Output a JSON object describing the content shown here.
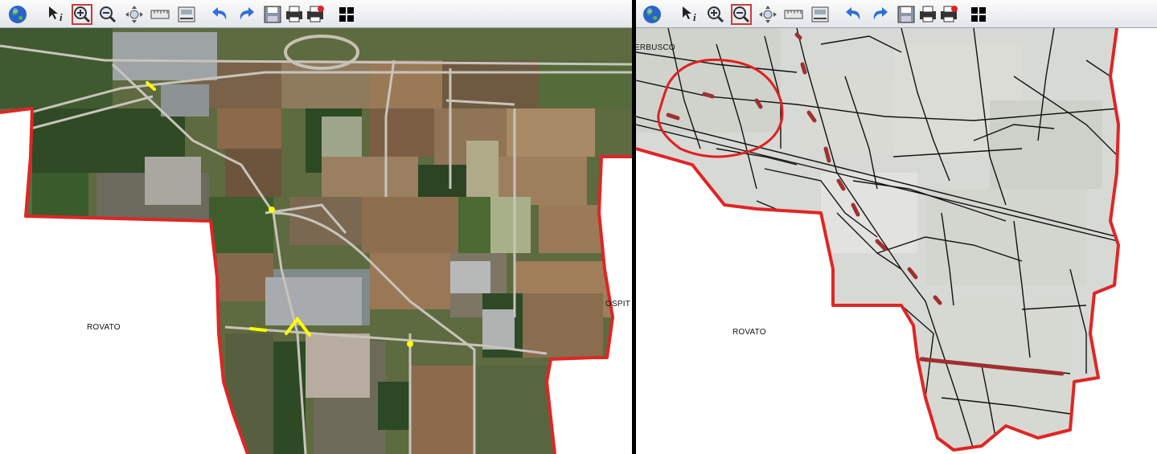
{
  "left_map": {
    "view": "satellite",
    "labels": {
      "rovato": "ROVATO",
      "ospit": "OSPIT"
    },
    "boundary_color": "#e02525",
    "highlight_color": "#ffff00"
  },
  "right_map": {
    "view": "road-network",
    "labels": {
      "erbusco": "ERBUSCO",
      "rovato": "ROVATO"
    },
    "boundary_color": "#e02525",
    "highlight_color": "#a03030"
  },
  "toolbar": {
    "tools": [
      {
        "name": "globe-icon",
        "color": "#2a63c9"
      },
      {
        "name": "identify-icon"
      },
      {
        "name": "zoom-in-icon"
      },
      {
        "name": "zoom-out-icon"
      },
      {
        "name": "pan-icon"
      },
      {
        "name": "measure-icon"
      },
      {
        "name": "scale-icon"
      },
      {
        "name": "undo-icon",
        "color": "#2f6fd6"
      },
      {
        "name": "redo-icon",
        "color": "#2f6fd6"
      },
      {
        "name": "save-icon"
      },
      {
        "name": "print-icon"
      },
      {
        "name": "print-pdf-icon"
      },
      {
        "name": "layers-grid-icon"
      }
    ]
  }
}
